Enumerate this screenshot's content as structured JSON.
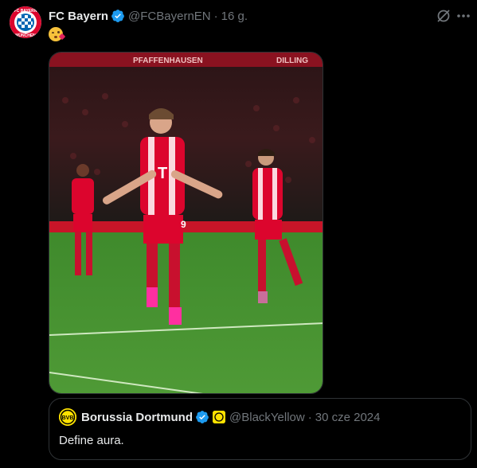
{
  "tweet": {
    "author_name": "FC Bayern",
    "handle": "@FCBayernEN",
    "separator": "·",
    "time": "16 g.",
    "avatar_text": "FC BAYERN MÜNCHEN",
    "media_banner": "PFAFFENHAUSEN",
    "media_banner_right": "DILLING",
    "shirt_number": "9"
  },
  "quote": {
    "author_name": "Borussia Dortmund",
    "handle": "@BlackYellow",
    "separator": "·",
    "date": "30 cze 2024",
    "text": "Define aura.",
    "avatar_text": "BVB"
  },
  "colors": {
    "background": "#000000",
    "text": "#e7e9ea",
    "muted": "#71767b",
    "verified_blue": "#1d9bf0",
    "bayern_red": "#dc052d",
    "bvb_yellow": "#fde100",
    "border": "#2f3336"
  },
  "icons": [
    "verified-badge-icon",
    "grok-icon",
    "more-icon",
    "kiss-emoji-icon",
    "affiliate-badge-icon"
  ]
}
